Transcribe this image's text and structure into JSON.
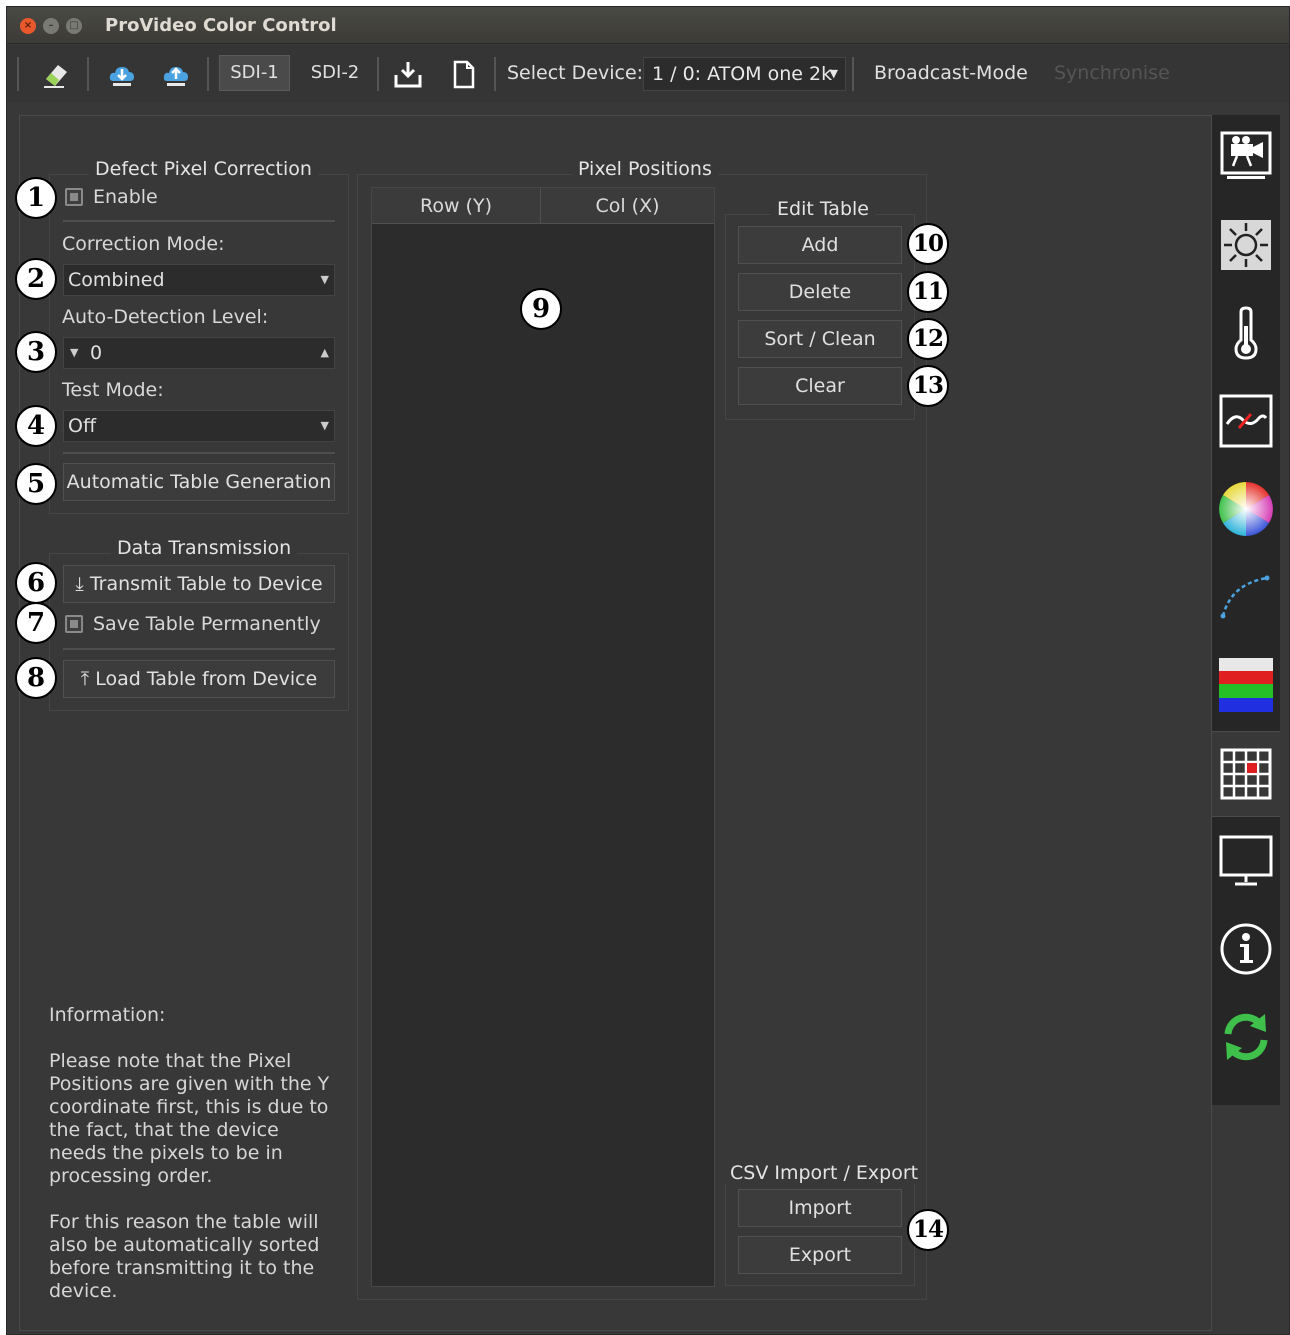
{
  "window": {
    "title": "ProVideo Color Control"
  },
  "toolbar": {
    "icons": [
      "eraser-icon",
      "download-cloud-icon",
      "upload-cloud-icon",
      "save-download-icon",
      "new-file-icon"
    ],
    "sdi1_label": "SDI-1",
    "sdi2_label": "SDI-2",
    "select_device_label": "Select Device:",
    "device_value": "1 / 0: ATOM one 2k",
    "broadcast_label": "Broadcast-Mode",
    "synchronise_label": "Synchronise"
  },
  "dpc": {
    "title": "Defect Pixel Correction",
    "enable_label": "Enable",
    "enable_checked": false,
    "correction_mode_label": "Correction Mode:",
    "correction_mode_value": "Combined",
    "auto_level_label": "Auto-Detection Level:",
    "auto_level_value": "0",
    "test_mode_label": "Test Mode:",
    "test_mode_value": "Off",
    "auto_table_button": "Automatic Table Generation"
  },
  "transmission": {
    "title": "Data Transmission",
    "transmit_button": "Transmit Table to Device",
    "save_perm_label": "Save Table Permanently",
    "save_perm_checked": false,
    "load_button": "Load Table from Device"
  },
  "pixel_positions": {
    "title": "Pixel Positions",
    "col_row": "Row (Y)",
    "col_col": "Col (X)",
    "rows": []
  },
  "edit_table": {
    "title": "Edit Table",
    "add": "Add",
    "delete": "Delete",
    "sort_clean": "Sort / Clean",
    "clear": "Clear"
  },
  "csv": {
    "title": "CSV Import / Export",
    "import": "Import",
    "export": "Export"
  },
  "info": {
    "heading": "Information:",
    "para1": "Please note that the Pixel Positions are given with the Y coordinate first, this is due to the fact, that the device needs the pixels to be in processing order.",
    "para2": "For this reason the table will also be automatically sorted before transmitting it to the device."
  },
  "sidebar_icons": [
    "camera-icon",
    "sun-icon",
    "thermometer-icon",
    "waveform-icon",
    "color-wheel-icon",
    "curve-icon",
    "rgb-bars-icon",
    "dpc-grid-icon",
    "monitor-icon",
    "info-icon",
    "refresh-icon"
  ],
  "callouts": [
    "1",
    "2",
    "3",
    "4",
    "5",
    "6",
    "7",
    "8",
    "9",
    "10",
    "11",
    "12",
    "13",
    "14"
  ]
}
